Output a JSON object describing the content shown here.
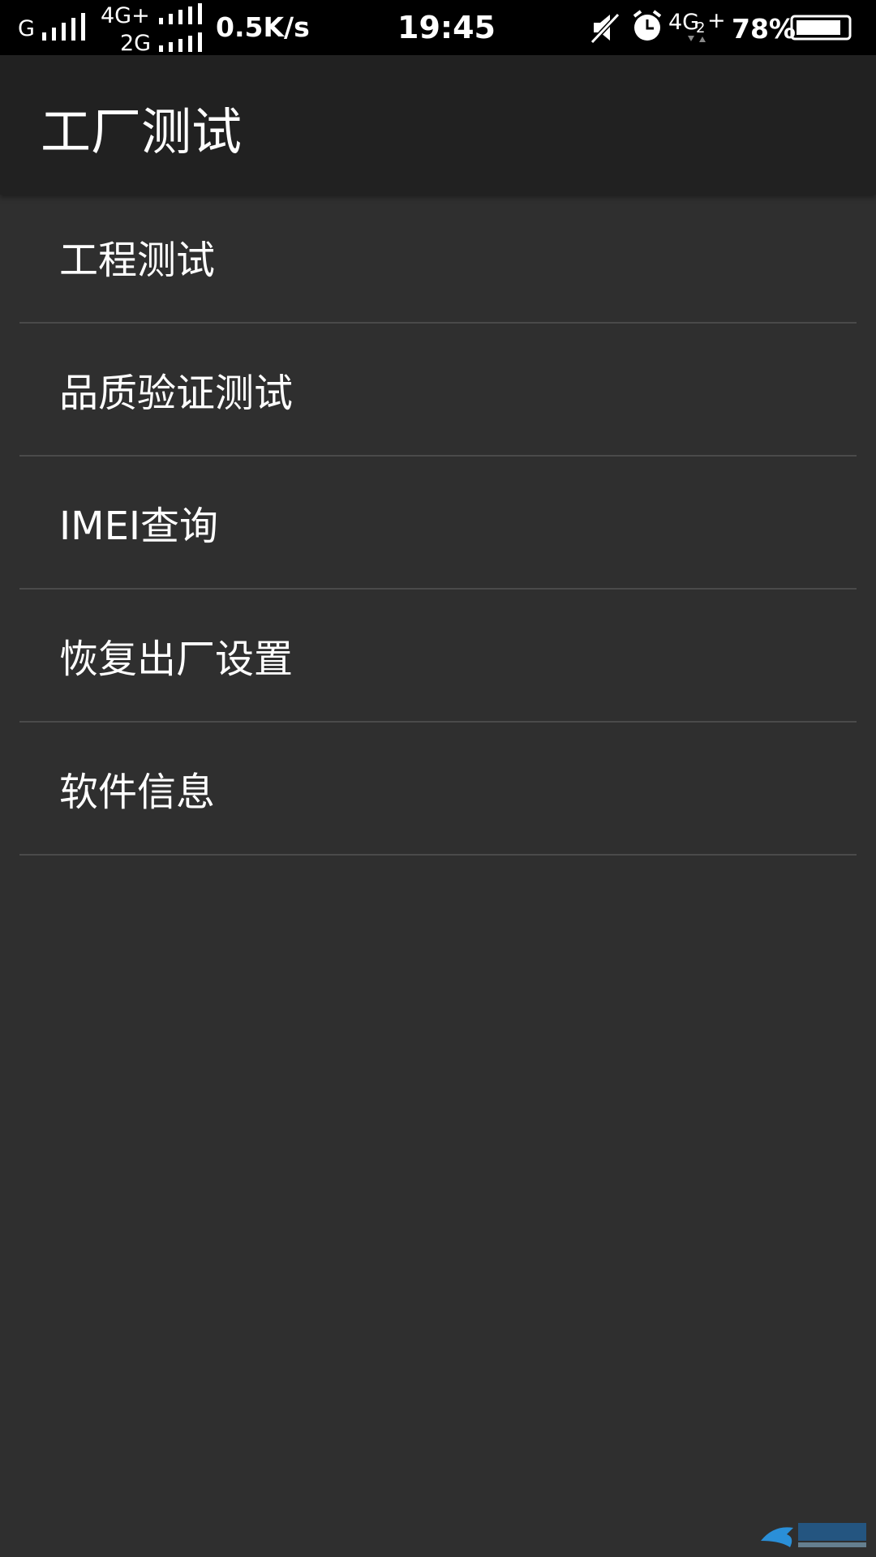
{
  "status_bar": {
    "carrier1": "G",
    "carrier2_top": "4G+",
    "carrier2_bottom": "2G",
    "speed": "0.5K/s",
    "time": "19:45",
    "network3": "4G",
    "network3_sub": "2",
    "network3_plus": "+",
    "battery": "78%"
  },
  "app_bar": {
    "title": "工厂测试"
  },
  "menu": {
    "items": [
      {
        "label": "工程测试"
      },
      {
        "label": "品质验证测试"
      },
      {
        "label": "IMEI查询"
      },
      {
        "label": "恢复出厂设置"
      },
      {
        "label": "软件信息"
      }
    ]
  },
  "colors": {
    "background": "#2f2f2f",
    "app_bar": "#212121",
    "status_bar": "#000000",
    "divider": "#4a4a4a",
    "text": "#ffffff"
  }
}
